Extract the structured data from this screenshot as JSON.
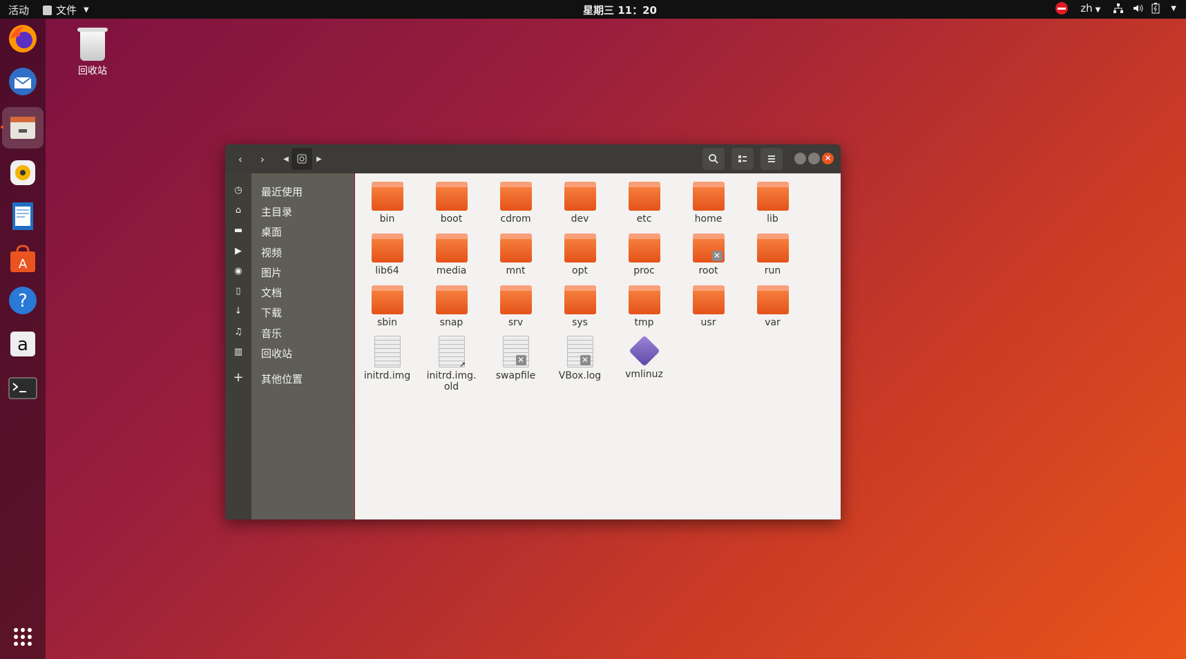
{
  "topbar": {
    "activities": "活动",
    "app_menu": "文件",
    "clock": "星期三 11：20",
    "lang": "zh"
  },
  "desktop": {
    "trash_label": "回收站"
  },
  "dock": {
    "items": [
      "firefox-icon",
      "thunderbird-icon",
      "files-icon",
      "rhythmbox-icon",
      "writer-icon",
      "software-icon",
      "help-icon",
      "amazon-icon",
      "terminal-icon",
      "app-grid-icon"
    ]
  },
  "sidebar": {
    "items": [
      {
        "label": "最近使用",
        "icon": "clock-icon"
      },
      {
        "label": "主目录",
        "icon": "home-icon"
      },
      {
        "label": "桌面",
        "icon": "folder-icon"
      },
      {
        "label": "视频",
        "icon": "video-icon"
      },
      {
        "label": "图片",
        "icon": "camera-icon"
      },
      {
        "label": "文档",
        "icon": "document-icon"
      },
      {
        "label": "下载",
        "icon": "download-icon"
      },
      {
        "label": "音乐",
        "icon": "music-icon"
      },
      {
        "label": "回收站",
        "icon": "trash-icon"
      },
      {
        "label": "其他位置",
        "icon": "plus-icon"
      }
    ]
  },
  "files": {
    "items": [
      {
        "name": "bin",
        "type": "folder"
      },
      {
        "name": "boot",
        "type": "folder"
      },
      {
        "name": "cdrom",
        "type": "folder"
      },
      {
        "name": "dev",
        "type": "folder"
      },
      {
        "name": "etc",
        "type": "folder"
      },
      {
        "name": "home",
        "type": "folder"
      },
      {
        "name": "lib",
        "type": "folder"
      },
      {
        "name": "lib64",
        "type": "folder"
      },
      {
        "name": "media",
        "type": "folder"
      },
      {
        "name": "mnt",
        "type": "folder"
      },
      {
        "name": "opt",
        "type": "folder"
      },
      {
        "name": "proc",
        "type": "folder"
      },
      {
        "name": "root",
        "type": "folder-locked"
      },
      {
        "name": "run",
        "type": "folder"
      },
      {
        "name": "sbin",
        "type": "folder"
      },
      {
        "name": "snap",
        "type": "folder"
      },
      {
        "name": "srv",
        "type": "folder"
      },
      {
        "name": "sys",
        "type": "folder"
      },
      {
        "name": "tmp",
        "type": "folder"
      },
      {
        "name": "usr",
        "type": "folder"
      },
      {
        "name": "var",
        "type": "folder"
      },
      {
        "name": "initrd.img",
        "type": "file"
      },
      {
        "name": "initrd.img.\nold",
        "type": "file-link"
      },
      {
        "name": "swapfile",
        "type": "file-locked"
      },
      {
        "name": "VBox.log",
        "type": "file-locked"
      },
      {
        "name": "vmlinuz",
        "type": "vmlinuz"
      }
    ]
  },
  "colors": {
    "accent": "#e95420",
    "topbar": "#111111",
    "sidebar": "#5f5e56"
  }
}
